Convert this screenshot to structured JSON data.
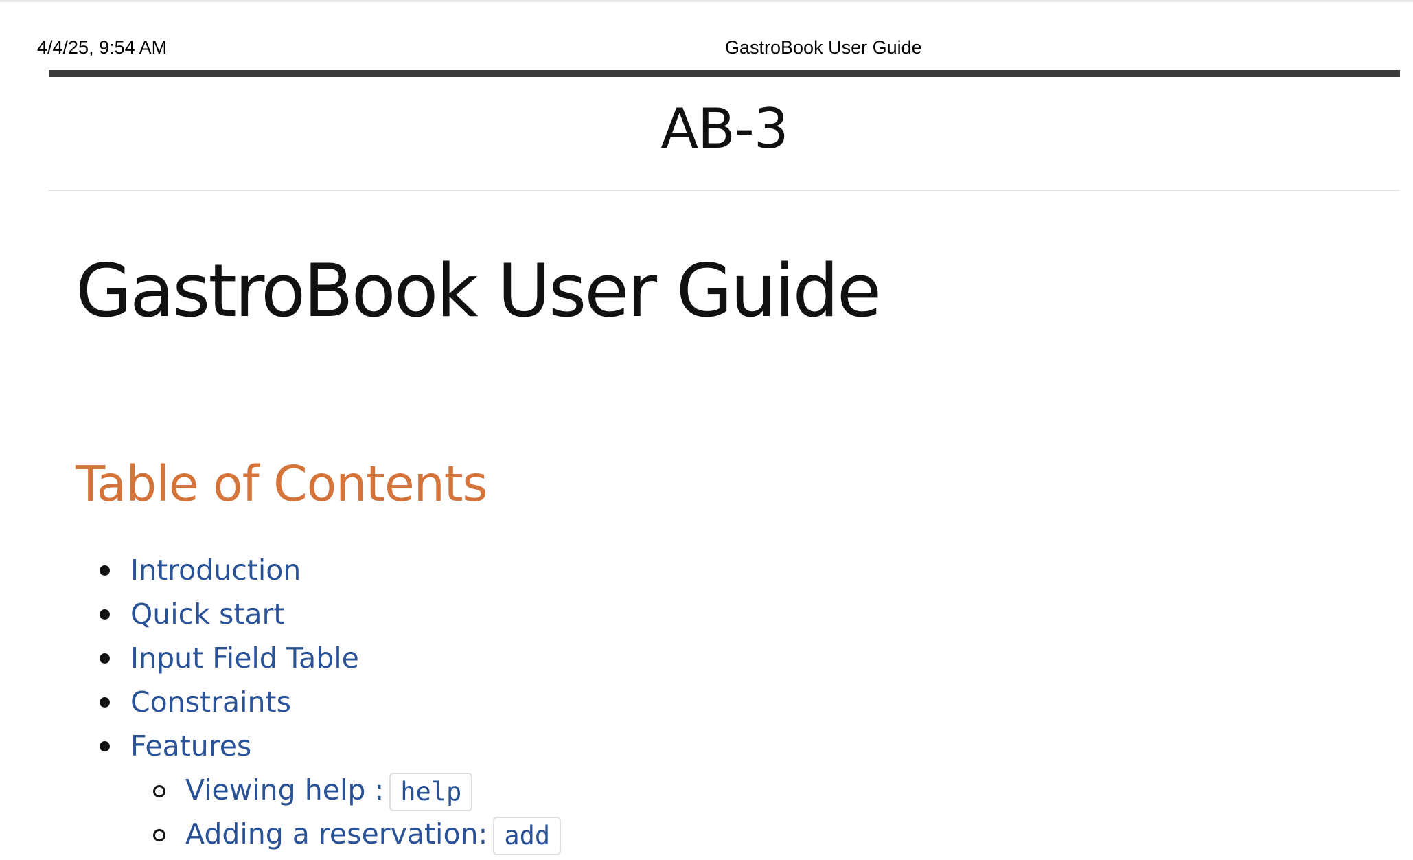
{
  "print_header": {
    "date": "4/4/25, 9:54 AM",
    "title": "GastroBook User Guide"
  },
  "site": {
    "title": "AB-3"
  },
  "page": {
    "title": "GastroBook User Guide"
  },
  "toc": {
    "heading": "Table of Contents",
    "items": [
      {
        "label": "Introduction"
      },
      {
        "label": "Quick start"
      },
      {
        "label": "Input Field Table"
      },
      {
        "label": "Constraints"
      },
      {
        "label": "Features"
      }
    ],
    "features_subitems": [
      {
        "label": "Viewing help :",
        "code": "help"
      },
      {
        "label": "Adding a reservation:",
        "code": "add"
      }
    ]
  },
  "colors": {
    "heading_accent": "#d4733a",
    "link": "#2a5297",
    "nav_bar": "#3b3b3b"
  }
}
